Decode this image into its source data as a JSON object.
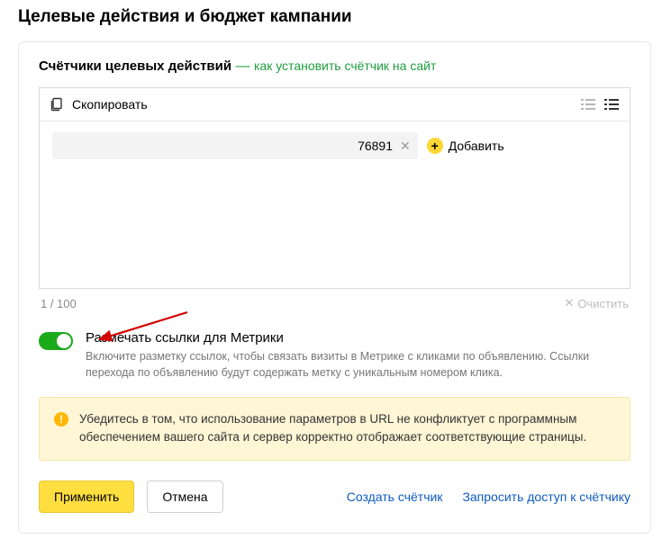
{
  "page_title": "Целевые действия и бюджет кампании",
  "header": {
    "label": "Счётчики целевых действий",
    "dash": "—",
    "link": "как установить счётчик на сайт"
  },
  "copy": {
    "label": "Скопировать"
  },
  "counter": {
    "chip_value": "76891",
    "add_label": "Добавить",
    "count_label": "1 / 100",
    "clear_label": "Очистить"
  },
  "toggle": {
    "title": "Размечать ссылки для Метрики",
    "description": "Включите разметку ссылок, чтобы связать визиты в Метрике с кликами по объявлению. Ссылки перехода по объявлению будут содержать метку с уникальным номером клика."
  },
  "notice": {
    "text": "Убедитесь в том, что использование параметров в URL не конфликтует с программным обеспечением вашего сайта и сервер корректно отображает соответствующие страницы."
  },
  "footer": {
    "apply": "Применить",
    "cancel": "Отмена",
    "create_counter": "Создать счётчик",
    "request_access": "Запросить доступ к счётчику"
  }
}
